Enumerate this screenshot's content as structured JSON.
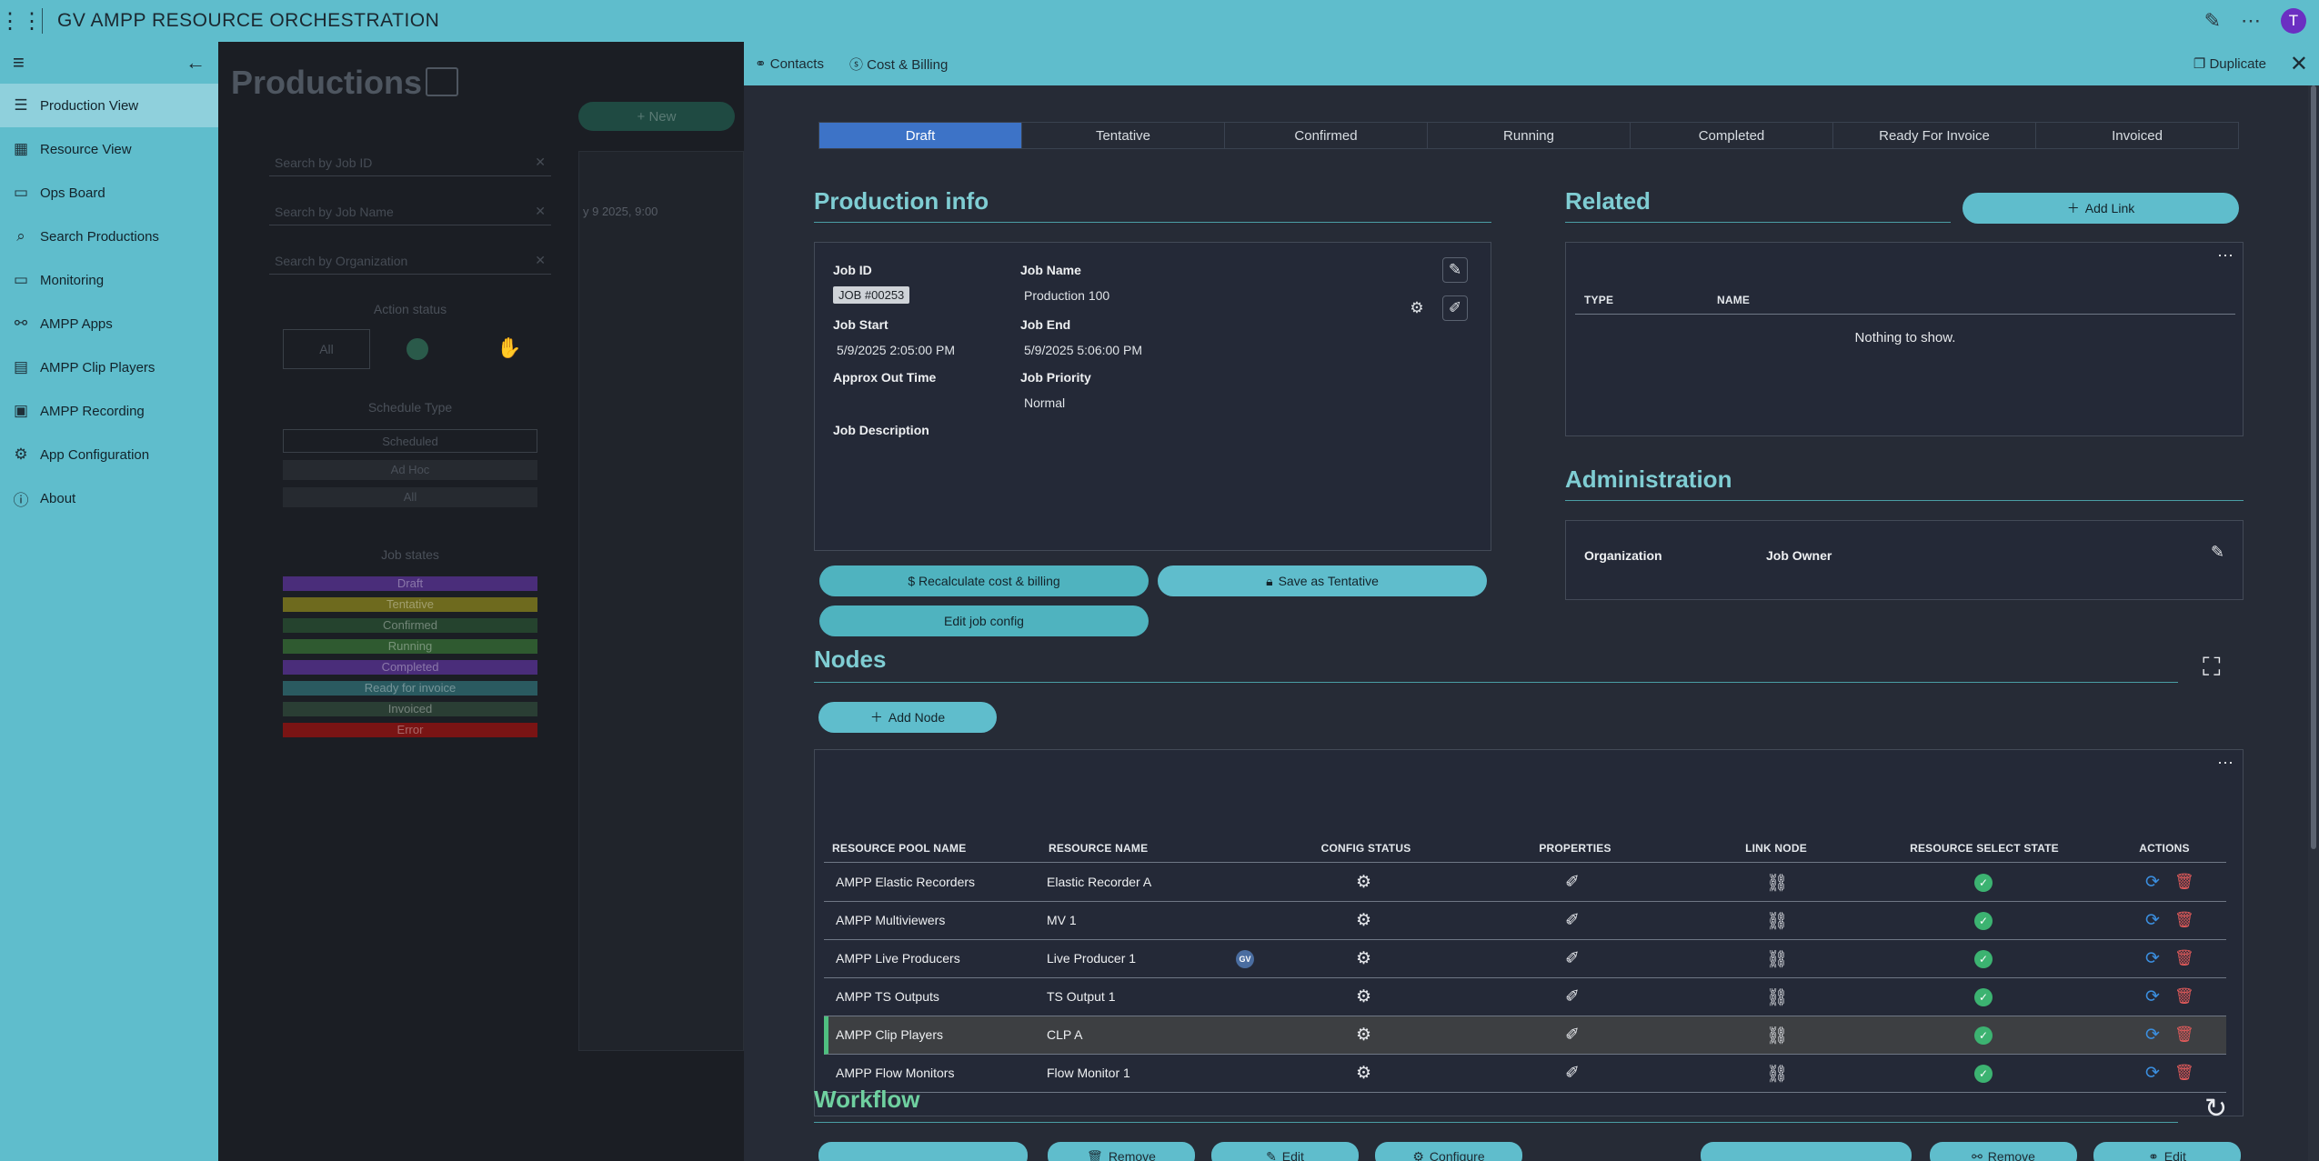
{
  "app": {
    "title": "GV AMPP RESOURCE ORCHESTRATION",
    "avatar": "T"
  },
  "sidebar": {
    "items": [
      {
        "label": "Production View",
        "icon": "list-icon"
      },
      {
        "label": "Resource View",
        "icon": "calendar-icon"
      },
      {
        "label": "Ops Board",
        "icon": "monitor-icon"
      },
      {
        "label": "Search Productions",
        "icon": "search-icon"
      },
      {
        "label": "Monitoring",
        "icon": "monitor-icon"
      },
      {
        "label": "AMPP Apps",
        "icon": "apps-icon"
      },
      {
        "label": "AMPP Clip Players",
        "icon": "clip-icon"
      },
      {
        "label": "AMPP Recording",
        "icon": "recording-icon"
      },
      {
        "label": "App Configuration",
        "icon": "gear-icon"
      },
      {
        "label": "About",
        "icon": "info-icon"
      }
    ]
  },
  "background": {
    "title": "Productions",
    "new_label": "+ New",
    "search_job_id": "Search by Job ID",
    "search_job_name": "Search by Job Name",
    "search_org": "Search by Organization",
    "date_text": "y 9 2025, 9:00",
    "action_status": "Action status",
    "all": "All",
    "schedule_type": "Schedule Type",
    "scheduled": "Scheduled",
    "adhoc": "Ad Hoc",
    "all2": "All",
    "job_states": "Job states",
    "states": [
      {
        "label": "Draft",
        "color": "#4a2d7a"
      },
      {
        "label": "Tentative",
        "color": "#6e6a1e"
      },
      {
        "label": "Confirmed",
        "color": "#25432e"
      },
      {
        "label": "Running",
        "color": "#2f5a30"
      },
      {
        "label": "Completed",
        "color": "#4a2d7a"
      },
      {
        "label": "Ready for invoice",
        "color": "#2a5a60"
      },
      {
        "label": "Invoiced",
        "color": "#2a3e34"
      },
      {
        "label": "Error",
        "color": "#7a1414"
      }
    ]
  },
  "panel": {
    "contacts": "Contacts",
    "cost_billing": "Cost & Billing",
    "duplicate": "Duplicate",
    "steps": [
      "Draft",
      "Tentative",
      "Confirmed",
      "Running",
      "Completed",
      "Ready For Invoice",
      "Invoiced"
    ],
    "active_step": "Draft",
    "production_info": "Production info",
    "job_id_label": "Job ID",
    "job_id": "JOB #00253",
    "job_name_label": "Job Name",
    "job_name": "Production 100",
    "job_start_label": "Job Start",
    "job_start": "5/9/2025 2:05:00 PM",
    "job_end_label": "Job End",
    "job_end": "5/9/2025 5:06:00 PM",
    "approx_out_label": "Approx Out Time",
    "job_priority_label": "Job Priority",
    "job_priority": "Normal",
    "job_desc_label": "Job Description",
    "recalc": "$ Recalculate cost & billing",
    "save_tentative": "Save as Tentative",
    "edit_config": "Edit job config",
    "related": "Related",
    "add_link": "Add Link",
    "rel_type": "TYPE",
    "rel_name": "NAME",
    "nothing": "Nothing to show.",
    "administration": "Administration",
    "organization": "Organization",
    "job_owner": "Job Owner",
    "nodes": "Nodes",
    "add_node": "Add Node",
    "headers": [
      "RESOURCE POOL NAME",
      "RESOURCE NAME",
      "CONFIG STATUS",
      "PROPERTIES",
      "LINK NODE",
      "RESOURCE SELECT STATE",
      "ACTIONS"
    ],
    "rows": [
      {
        "pool": "AMPP Elastic Recorders",
        "name": "Elastic Recorder A"
      },
      {
        "pool": "AMPP Multiviewers",
        "name": "MV 1"
      },
      {
        "pool": "AMPP Live Producers",
        "name": "Live Producer 1"
      },
      {
        "pool": "AMPP TS Outputs",
        "name": "TS Output 1"
      },
      {
        "pool": "AMPP Clip Players",
        "name": "CLP A"
      },
      {
        "pool": "AMPP Flow Monitors",
        "name": "Flow Monitor 1"
      }
    ],
    "gv_badge": "GV",
    "workflow": "Workflow",
    "wf_remove": "Remove",
    "wf_edit": "Edit",
    "wf_configure": "Configure",
    "wf_remove2": "Remove",
    "wf_edit2": "Edit"
  }
}
